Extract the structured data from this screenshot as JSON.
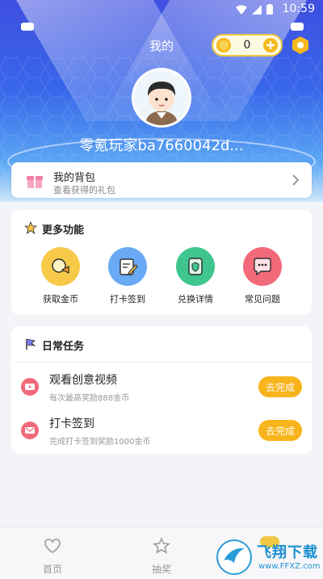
{
  "status_bar": {
    "time": "10:59"
  },
  "header": {
    "title": "我的",
    "coin_count": "0",
    "username": "零氪玩家ba7660042d..."
  },
  "bag": {
    "title": "我的背包",
    "subtitle": "查看获得的礼包"
  },
  "more_functions": {
    "title": "更多功能",
    "items": [
      {
        "label": "获取金币",
        "color": "#f7c948"
      },
      {
        "label": "打卡签到",
        "color": "#6aa9f5"
      },
      {
        "label": "兑换详情",
        "color": "#3fc58e"
      },
      {
        "label": "常见问题",
        "color": "#f26a7a"
      }
    ]
  },
  "daily_tasks": {
    "title": "日常任务",
    "tasks": [
      {
        "name": "观看创意视频",
        "desc": "每次最高奖励888金币",
        "button": "去完成"
      },
      {
        "name": "打卡签到",
        "desc": "完成打卡签到奖励1000金币",
        "button": "去完成"
      }
    ]
  },
  "tab_bar": {
    "tabs": [
      {
        "label": "首页"
      },
      {
        "label": "抽奖"
      }
    ]
  },
  "watermark": {
    "cn": "飞翔下载",
    "en": "www.FFXZ.com"
  },
  "colors": {
    "accent": "#f7b41b",
    "header_blue": "#3867ea",
    "coin_yellow": "#f0c843"
  }
}
